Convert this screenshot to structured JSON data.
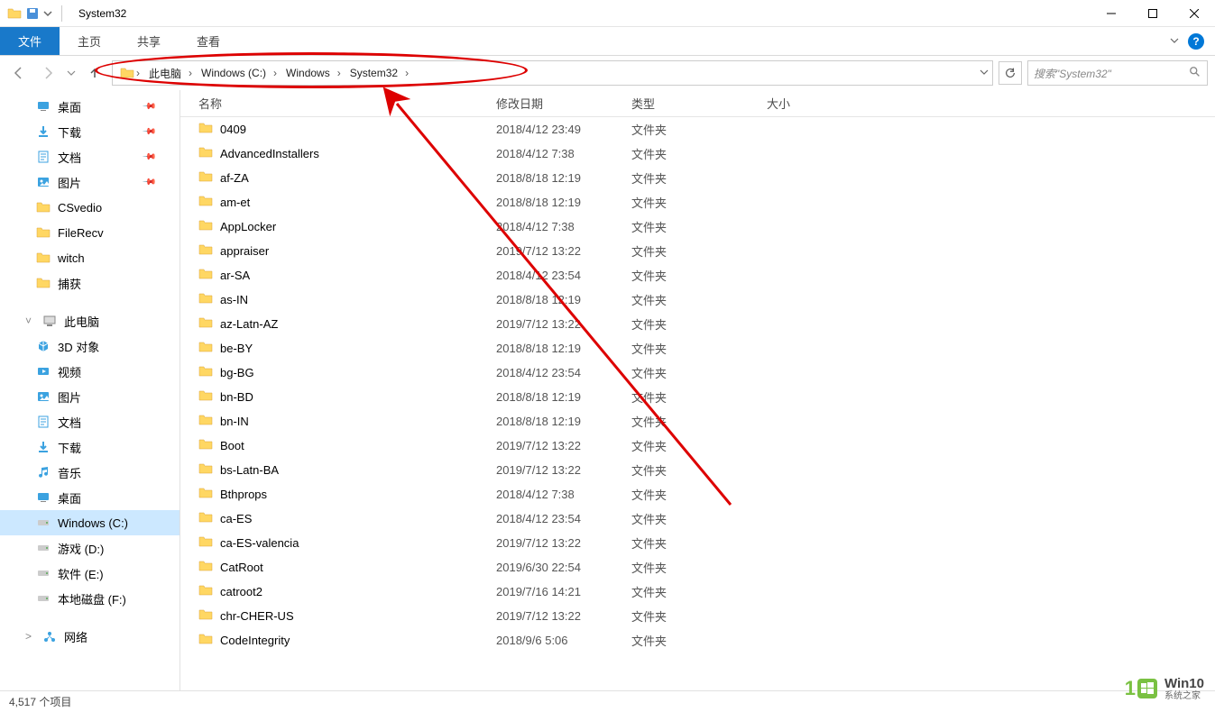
{
  "window": {
    "title": "System32"
  },
  "ribbon": {
    "file": "文件",
    "home": "主页",
    "share": "共享",
    "view": "查看"
  },
  "breadcrumbs": [
    "此电脑",
    "Windows (C:)",
    "Windows",
    "System32"
  ],
  "search": {
    "placeholder": "搜索\"System32\""
  },
  "sidebar": {
    "quick": [
      {
        "label": "桌面",
        "icon": "desktop",
        "pinned": true
      },
      {
        "label": "下载",
        "icon": "downloads",
        "pinned": true
      },
      {
        "label": "文档",
        "icon": "documents",
        "pinned": true
      },
      {
        "label": "图片",
        "icon": "pictures",
        "pinned": true
      },
      {
        "label": "CSvedio",
        "icon": "folder",
        "pinned": false
      },
      {
        "label": "FileRecv",
        "icon": "folder",
        "pinned": false
      },
      {
        "label": "witch",
        "icon": "folder",
        "pinned": false
      },
      {
        "label": "捕获",
        "icon": "folder",
        "pinned": false
      }
    ],
    "thispc_label": "此电脑",
    "thispc": [
      {
        "label": "3D 对象",
        "icon": "3d"
      },
      {
        "label": "视频",
        "icon": "video"
      },
      {
        "label": "图片",
        "icon": "pictures"
      },
      {
        "label": "文档",
        "icon": "documents"
      },
      {
        "label": "下载",
        "icon": "downloads"
      },
      {
        "label": "音乐",
        "icon": "music"
      },
      {
        "label": "桌面",
        "icon": "desktop"
      },
      {
        "label": "Windows (C:)",
        "icon": "drive",
        "selected": true
      },
      {
        "label": "游戏 (D:)",
        "icon": "drive"
      },
      {
        "label": "软件 (E:)",
        "icon": "drive"
      },
      {
        "label": "本地磁盘 (F:)",
        "icon": "drive"
      }
    ],
    "network_label": "网络"
  },
  "columns": {
    "name": "名称",
    "date": "修改日期",
    "type": "类型",
    "size": "大小"
  },
  "type_folder": "文件夹",
  "files": [
    {
      "name": "0409",
      "date": "2018/4/12 23:49"
    },
    {
      "name": "AdvancedInstallers",
      "date": "2018/4/12 7:38"
    },
    {
      "name": "af-ZA",
      "date": "2018/8/18 12:19"
    },
    {
      "name": "am-et",
      "date": "2018/8/18 12:19"
    },
    {
      "name": "AppLocker",
      "date": "2018/4/12 7:38"
    },
    {
      "name": "appraiser",
      "date": "2019/7/12 13:22"
    },
    {
      "name": "ar-SA",
      "date": "2018/4/12 23:54"
    },
    {
      "name": "as-IN",
      "date": "2018/8/18 12:19"
    },
    {
      "name": "az-Latn-AZ",
      "date": "2019/7/12 13:22"
    },
    {
      "name": "be-BY",
      "date": "2018/8/18 12:19"
    },
    {
      "name": "bg-BG",
      "date": "2018/4/12 23:54"
    },
    {
      "name": "bn-BD",
      "date": "2018/8/18 12:19"
    },
    {
      "name": "bn-IN",
      "date": "2018/8/18 12:19"
    },
    {
      "name": "Boot",
      "date": "2019/7/12 13:22"
    },
    {
      "name": "bs-Latn-BA",
      "date": "2019/7/12 13:22"
    },
    {
      "name": "Bthprops",
      "date": "2018/4/12 7:38"
    },
    {
      "name": "ca-ES",
      "date": "2018/4/12 23:54"
    },
    {
      "name": "ca-ES-valencia",
      "date": "2019/7/12 13:22"
    },
    {
      "name": "CatRoot",
      "date": "2019/6/30 22:54"
    },
    {
      "name": "catroot2",
      "date": "2019/7/16 14:21"
    },
    {
      "name": "chr-CHER-US",
      "date": "2019/7/12 13:22"
    },
    {
      "name": "CodeIntegrity",
      "date": "2018/9/6 5:06"
    }
  ],
  "status": {
    "items": "4,517 个项目"
  },
  "watermark": {
    "brand": "Win10",
    "sub": "系统之家"
  }
}
